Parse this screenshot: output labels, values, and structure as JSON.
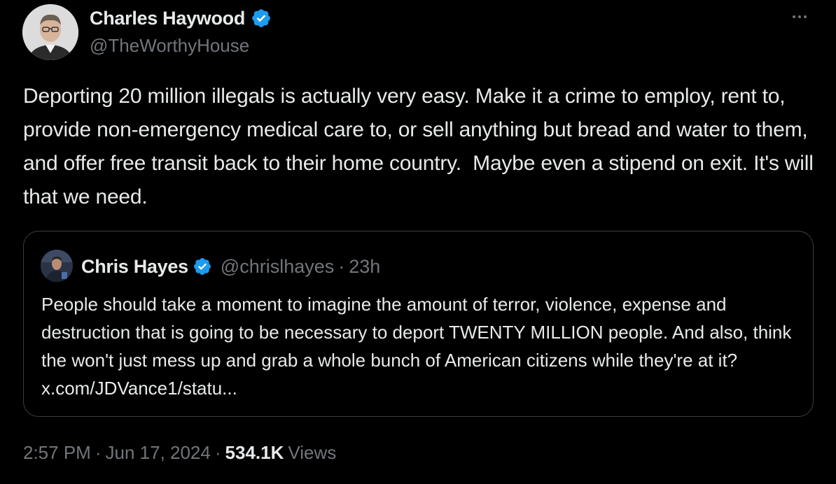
{
  "author": {
    "name": "Charles Haywood",
    "handle": "@TheWorthyHouse",
    "verified_icon": "verified-badge-icon",
    "avatar": "author-avatar"
  },
  "more_icon": "more-options-icon",
  "tweet": {
    "text": "Deporting 20 million illegals is actually very easy. Make it a crime to employ, rent to, provide non-emergency medical care to, or sell anything but bread and water to them, and offer free transit back to their home country.  Maybe even a stipend on exit. It's will that we need."
  },
  "quote": {
    "name": "Chris Hayes",
    "handle": "@chrislhayes",
    "separator": "·",
    "time": "23h",
    "text": "People should take a moment to imagine the amount of terror, violence, expense and destruction that is going to be necessary to deport TWENTY MILLION people. And also, think the won't just mess up and grab a whole bunch of American citizens while they're at it? x.com/JDVance1/statu..."
  },
  "footer": {
    "time": "2:57 PM",
    "sep1": "·",
    "date": "Jun 17, 2024",
    "sep2": "·",
    "views_count": "534.1K",
    "views_label": "Views"
  },
  "colors": {
    "background": "#000000",
    "text": "#e7e9ea",
    "muted": "#71767b",
    "verified": "#1d9bf0",
    "border": "#3a3f44"
  }
}
